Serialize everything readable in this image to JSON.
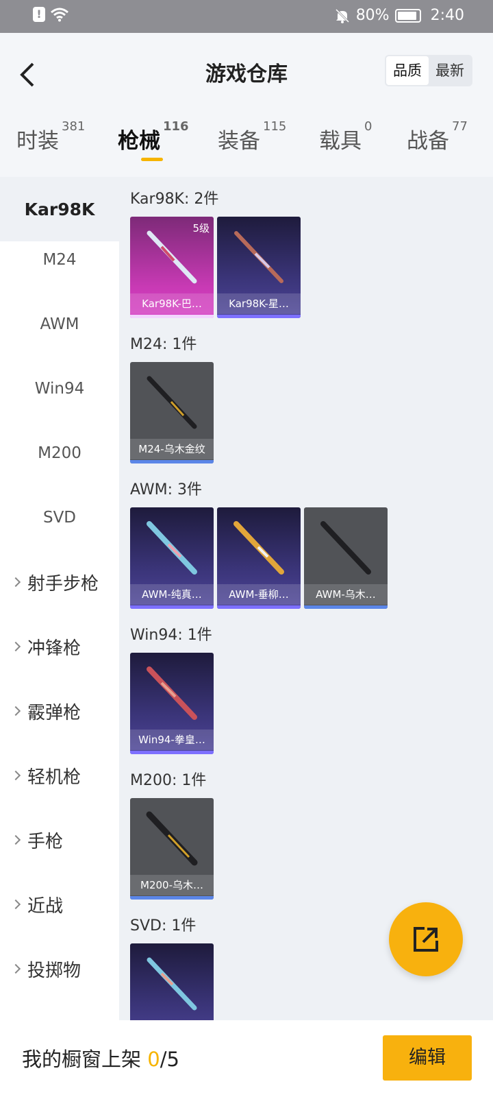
{
  "status_bar": {
    "battery": "80%",
    "time": "2:40"
  },
  "header": {
    "title": "游戏仓库",
    "sort_options": [
      "品质",
      "最新"
    ]
  },
  "tabs": [
    {
      "label": "时装",
      "count": "381"
    },
    {
      "label": "枪械",
      "count": "116"
    },
    {
      "label": "装备",
      "count": "115"
    },
    {
      "label": "载具",
      "count": "0"
    },
    {
      "label": "战备",
      "count": "77"
    }
  ],
  "sidebar": {
    "items": [
      "Kar98K",
      "M24",
      "AWM",
      "Win94",
      "M200",
      "SVD"
    ],
    "groups": [
      "射手步枪",
      "冲锋枪",
      "霰弹枪",
      "轻机枪",
      "手枪",
      "近战",
      "投掷物"
    ]
  },
  "sections": [
    {
      "title": "Kar98K: 2件",
      "items": [
        {
          "name": "Kar98K-巴…",
          "level": "5级",
          "style": "pink"
        },
        {
          "name": "Kar98K-星…",
          "style": "purple"
        }
      ]
    },
    {
      "title": "M24: 1件",
      "items": [
        {
          "name": "M24-乌木金纹",
          "style": "gray"
        }
      ]
    },
    {
      "title": "AWM: 3件",
      "items": [
        {
          "name": "AWM-纯真…",
          "style": "purple"
        },
        {
          "name": "AWM-垂柳…",
          "style": "purple"
        },
        {
          "name": "AWM-乌木…",
          "style": "gray"
        }
      ]
    },
    {
      "title": "Win94: 1件",
      "items": [
        {
          "name": "Win94-拳皇…",
          "style": "purple"
        }
      ]
    },
    {
      "title": "M200: 1件",
      "items": [
        {
          "name": "M200-乌木…",
          "style": "gray"
        }
      ]
    },
    {
      "title": "SVD: 1件",
      "items": [
        {
          "name": "",
          "style": "purple"
        }
      ]
    }
  ],
  "footer": {
    "label": "我的橱窗上架",
    "current": "0",
    "total": "/5",
    "edit_button": "编辑"
  },
  "colors": {
    "accent": "#f8b10e",
    "pink": "#c93ab5",
    "purple": "#3a3478",
    "gray": "#515357",
    "bar_pink": "#e0e0ff",
    "bar_purple": "#7d70ff",
    "bar_gray": "#5b86e8"
  }
}
